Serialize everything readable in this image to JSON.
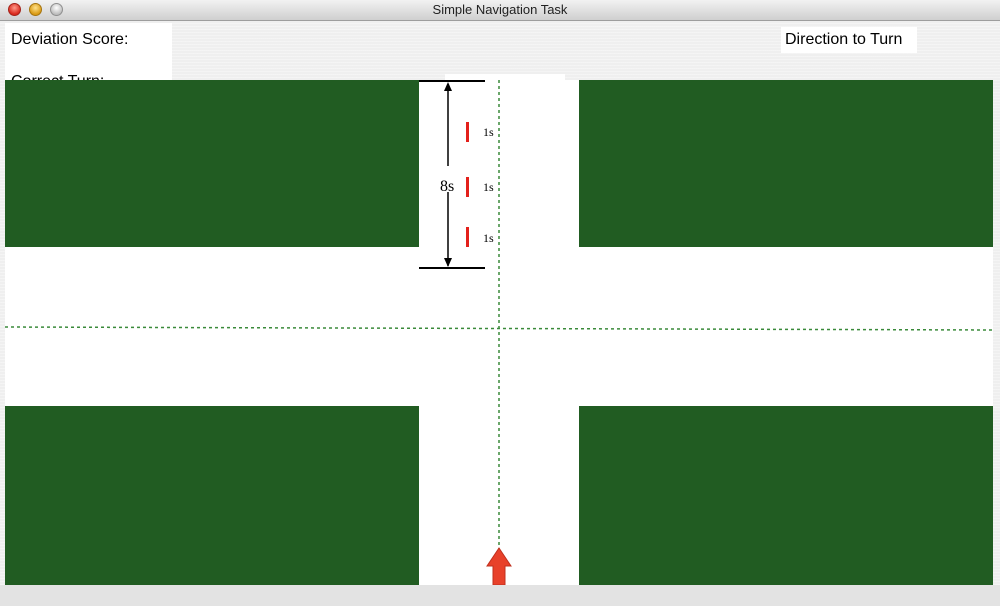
{
  "window": {
    "title": "Simple Navigation Task"
  },
  "labels": {
    "deviation_score": "Deviation Score:",
    "correct_turn": "Correct Turn:",
    "direction_to_turn": "Direction to Turn"
  },
  "map": {
    "total_duration": "8s",
    "markers": [
      {
        "label": "1s"
      },
      {
        "label": "1s"
      },
      {
        "label": "1s"
      }
    ],
    "colors": {
      "block": "#215c22",
      "road": "#ffffff",
      "guide_line": "#3a8a3a",
      "marker": "#e3201b",
      "arrow": "#e8412a"
    }
  }
}
